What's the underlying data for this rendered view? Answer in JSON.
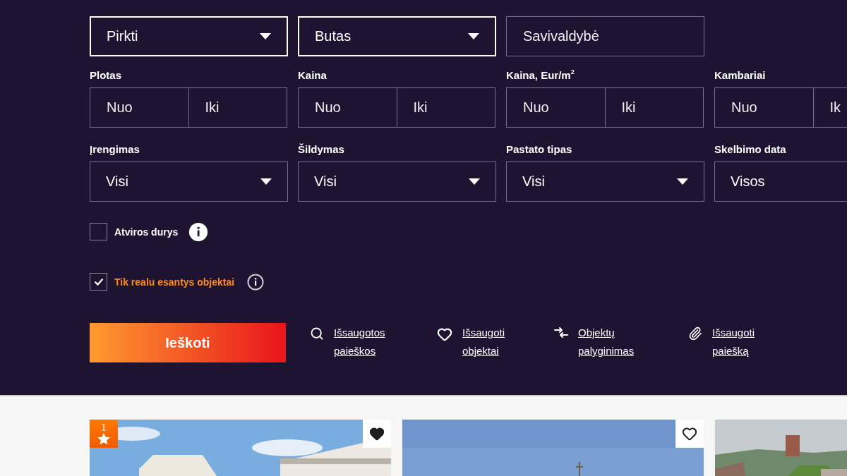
{
  "search_panel": {
    "top_fields": [
      {
        "kind": "select",
        "value": "Pirkti",
        "active": true
      },
      {
        "kind": "select",
        "value": "Butas",
        "active": true
      },
      {
        "kind": "input",
        "placeholder": "Savivaldybė",
        "active": false
      }
    ],
    "range_filters": [
      {
        "label": "Plotas",
        "from": {
          "placeholder": "Nuo"
        },
        "to": {
          "placeholder": "Iki"
        }
      },
      {
        "label": "Kaina",
        "from": {
          "placeholder": "Nuo"
        },
        "to": {
          "placeholder": "Iki"
        }
      },
      {
        "label": "Kaina, Eur/m$^{2}$",
        "from": {
          "placeholder": "Nuo"
        },
        "to": {
          "placeholder": "Iki"
        }
      },
      {
        "label": "Kambariai",
        "from": {
          "placeholder": "Nuo"
        },
        "to": {
          "placeholder": "Ik"
        }
      }
    ],
    "select_filters": [
      {
        "label": "Įrengimas",
        "value": "Visi"
      },
      {
        "label": "Šildymas",
        "value": "Visi"
      },
      {
        "label": "Pastato tipas",
        "value": "Visi"
      },
      {
        "label": "Skelbimo data",
        "value": "Visos"
      }
    ],
    "checkboxes": [
      {
        "label": "Atviros durys",
        "checked": false
      },
      {
        "label": "Tik realu esantys objektai",
        "checked": true
      }
    ],
    "search_button": "Ieškoti",
    "links": [
      {
        "kind": "search",
        "text": "Išsaugotos paieškos"
      },
      {
        "kind": "heart",
        "text": "Išsaugoti objektai"
      },
      {
        "kind": "compare",
        "text": "Objektų palyginimas"
      },
      {
        "kind": "clip",
        "text": "Išsaugoti paiešką"
      }
    ]
  },
  "listings": [
    {
      "picture": {
        "kind": "picture"
      },
      "badge": "1",
      "saved": true
    },
    {
      "picture": {
        "kind": "picture"
      },
      "saved": false
    },
    {
      "picture": {
        "kind": "picture"
      }
    }
  ]
}
